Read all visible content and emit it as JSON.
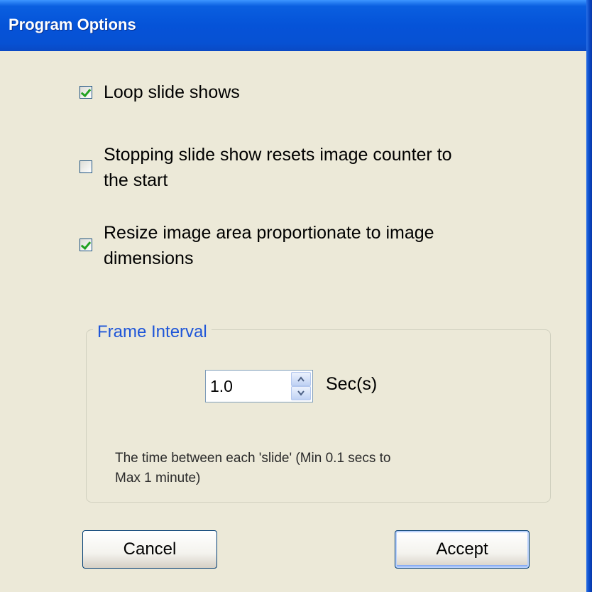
{
  "window": {
    "title": "Program Options"
  },
  "options": [
    {
      "label": "Loop slide shows",
      "checked": true
    },
    {
      "label_line1": "Stopping slide show resets image counter to",
      "label_line2": "the start",
      "checked": false
    },
    {
      "label_line1": "Resize image area proportionate to image",
      "label_line2": "dimensions",
      "checked": true
    }
  ],
  "frame_interval": {
    "group_label": "Frame Interval",
    "value": "1.0",
    "unit": "Sec(s)",
    "hint_line1": "The time between each 'slide' (Min 0.1 secs to",
    "hint_line2": "Max 1 minute)"
  },
  "buttons": {
    "cancel": "Cancel",
    "accept": "Accept"
  },
  "colors": {
    "titlebar": "#0553d8",
    "dialog_bg": "#ece9d8",
    "group_label": "#1f56d8",
    "check_mark": "#21a121"
  }
}
